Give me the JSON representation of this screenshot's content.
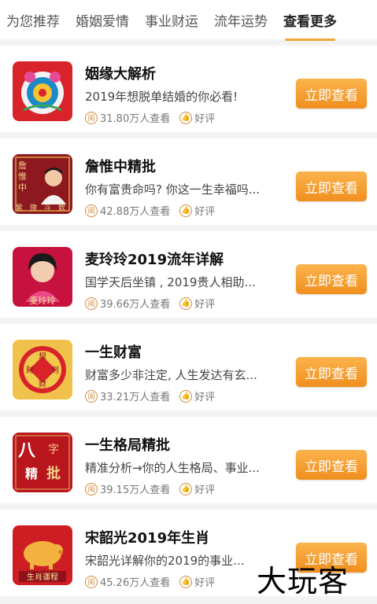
{
  "tabs": [
    "为您推荐",
    "婚姻爱情",
    "事业财运",
    "流年运势",
    "查看更多"
  ],
  "active_tab": 4,
  "colors": {
    "accent": "#f3a43a",
    "button": "#f7a030",
    "icon": "#d28a3c"
  },
  "items": [
    {
      "title": "姻缘大解析",
      "desc": "2019年想脱单结婚的你必看!",
      "views": "31.80万人查看",
      "rating": "好评",
      "button": "立即查看",
      "thumb_icon": "wedding-lotus-icon"
    },
    {
      "title": "詹惟中精批",
      "desc": "你有富贵命吗? 你这一生幸福吗...",
      "views": "42.88万人查看",
      "rating": "好评",
      "button": "立即查看",
      "thumb_icon": "master-portrait-icon"
    },
    {
      "title": "麦玲玲2019流年详解",
      "desc": "国学天后坐镇 , 2019贵人相助...",
      "views": "39.66万人查看",
      "rating": "好评",
      "button": "立即查看",
      "thumb_icon": "master-portrait-icon"
    },
    {
      "title": "一生财富",
      "desc": "财富多少非注定, 人生发达有玄...",
      "views": "33.21万人查看",
      "rating": "好评",
      "button": "立即查看",
      "thumb_icon": "fortune-coin-icon"
    },
    {
      "title": "一生格局精批",
      "desc": "精准分析→你的人生格局、事业...",
      "views": "39.15万人查看",
      "rating": "好评",
      "button": "立即查看",
      "thumb_icon": "calligraphy-icon"
    },
    {
      "title": "宋韶光2019年生肖",
      "desc": "宋韶光详解你的2019的事业...",
      "views": "45.26万人查看",
      "rating": "好评",
      "button": "立即查看",
      "thumb_icon": "pig-zodiac-icon"
    }
  ],
  "thumb_text": {
    "t2": [
      "詹",
      "惟",
      "中",
      "紫",
      "微",
      "斗",
      "数"
    ],
    "t3": "麦玲玲",
    "t4": [
      "规",
      "财",
      "则",
      "财"
    ],
    "t5": [
      "八",
      "字",
      "精",
      "批"
    ],
    "t6": "生肖運程"
  },
  "watermark": "大玩客"
}
